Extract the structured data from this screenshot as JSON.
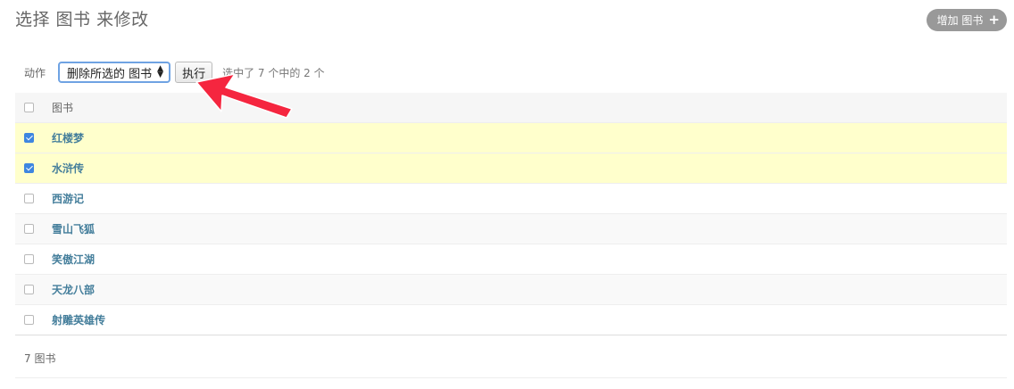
{
  "page": {
    "title": "选择 图书 来修改",
    "add_button_label": "增加 图书",
    "add_icon": "plus-icon"
  },
  "actions": {
    "label": "动作",
    "selected_action": "删除所选的 图书",
    "go_label": "执行",
    "counter": "选中了 7 个中的 2 个"
  },
  "table": {
    "header": "图书",
    "rows": [
      {
        "name": "红楼梦",
        "checked": true
      },
      {
        "name": "水浒传",
        "checked": true
      },
      {
        "name": "西游记",
        "checked": false
      },
      {
        "name": "雪山飞狐",
        "checked": false
      },
      {
        "name": "笑傲江湖",
        "checked": false
      },
      {
        "name": "天龙八部",
        "checked": false
      },
      {
        "name": "射雕英雄传",
        "checked": false
      }
    ]
  },
  "paginator": {
    "text": "7 图书"
  },
  "colors": {
    "annotation_arrow": "#f5263f",
    "link": "#447e9b",
    "selected_row": "#ffffcc"
  }
}
